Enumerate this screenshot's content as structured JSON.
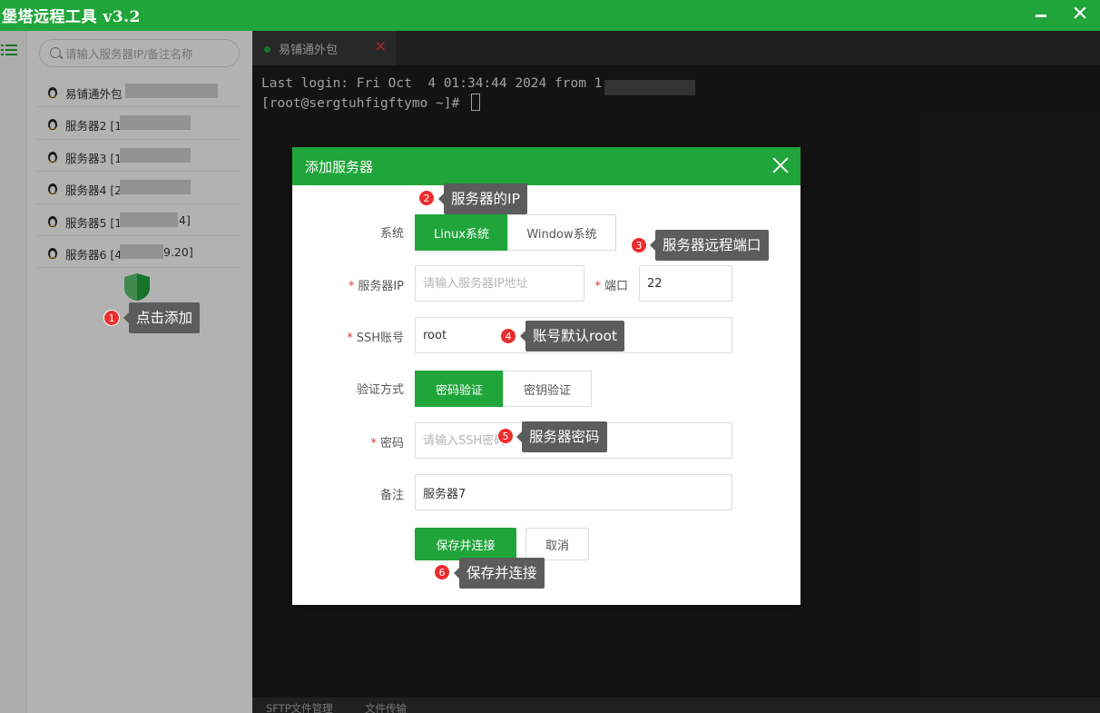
{
  "app": {
    "title": "堡塔远程工具 v3.2"
  },
  "colors": {
    "accent": "#20a53a",
    "terminal_bg": "#1c1c1c",
    "badge": "#ea2c2c",
    "callout": "#5c5c5c"
  },
  "sidebar": {
    "search_placeholder": "请输入服务器IP/备注名称",
    "servers": [
      {
        "label": "易铺通外包",
        "tail": ""
      },
      {
        "label": "服务器2 [1",
        "tail": ""
      },
      {
        "label": "服务器3 [1",
        "tail": ""
      },
      {
        "label": "服务器4 [2",
        "tail": ""
      },
      {
        "label": "服务器5 [1",
        "tail": "4]"
      },
      {
        "label": "服务器6 [4",
        "tail": "9.20]"
      }
    ]
  },
  "terminal": {
    "tab_title": "易铺通外包",
    "lines": [
      "Last login: Fri Oct  4 01:34:44 2024 from 1",
      "[root@sergtuhfigftymo ~]# "
    ],
    "bottom_tabs": [
      "SFTP文件管理",
      "文件传输"
    ]
  },
  "dialog": {
    "title": "添加服务器",
    "system_label": "系统",
    "system_options": [
      "Linux系统",
      "Window系统"
    ],
    "ip_label": "服务器IP",
    "ip_placeholder": "请输入服务器IP地址",
    "port_label": "端口",
    "port_value": "22",
    "ssh_label": "SSH账号",
    "ssh_value": "root",
    "auth_label": "验证方式",
    "auth_options": [
      "密码验证",
      "密钥验证"
    ],
    "password_label": "密码",
    "password_placeholder": "请输入SSH密码",
    "remark_label": "备注",
    "remark_value": "服务器7",
    "save_label": "保存并连接",
    "cancel_label": "取消"
  },
  "annotations": [
    {
      "num": "1",
      "text": "点击添加"
    },
    {
      "num": "2",
      "text": "服务器的IP"
    },
    {
      "num": "3",
      "text": "服务器远程端口"
    },
    {
      "num": "4",
      "text": "账号默认root"
    },
    {
      "num": "5",
      "text": "服务器密码"
    },
    {
      "num": "6",
      "text": "保存并连接"
    }
  ]
}
